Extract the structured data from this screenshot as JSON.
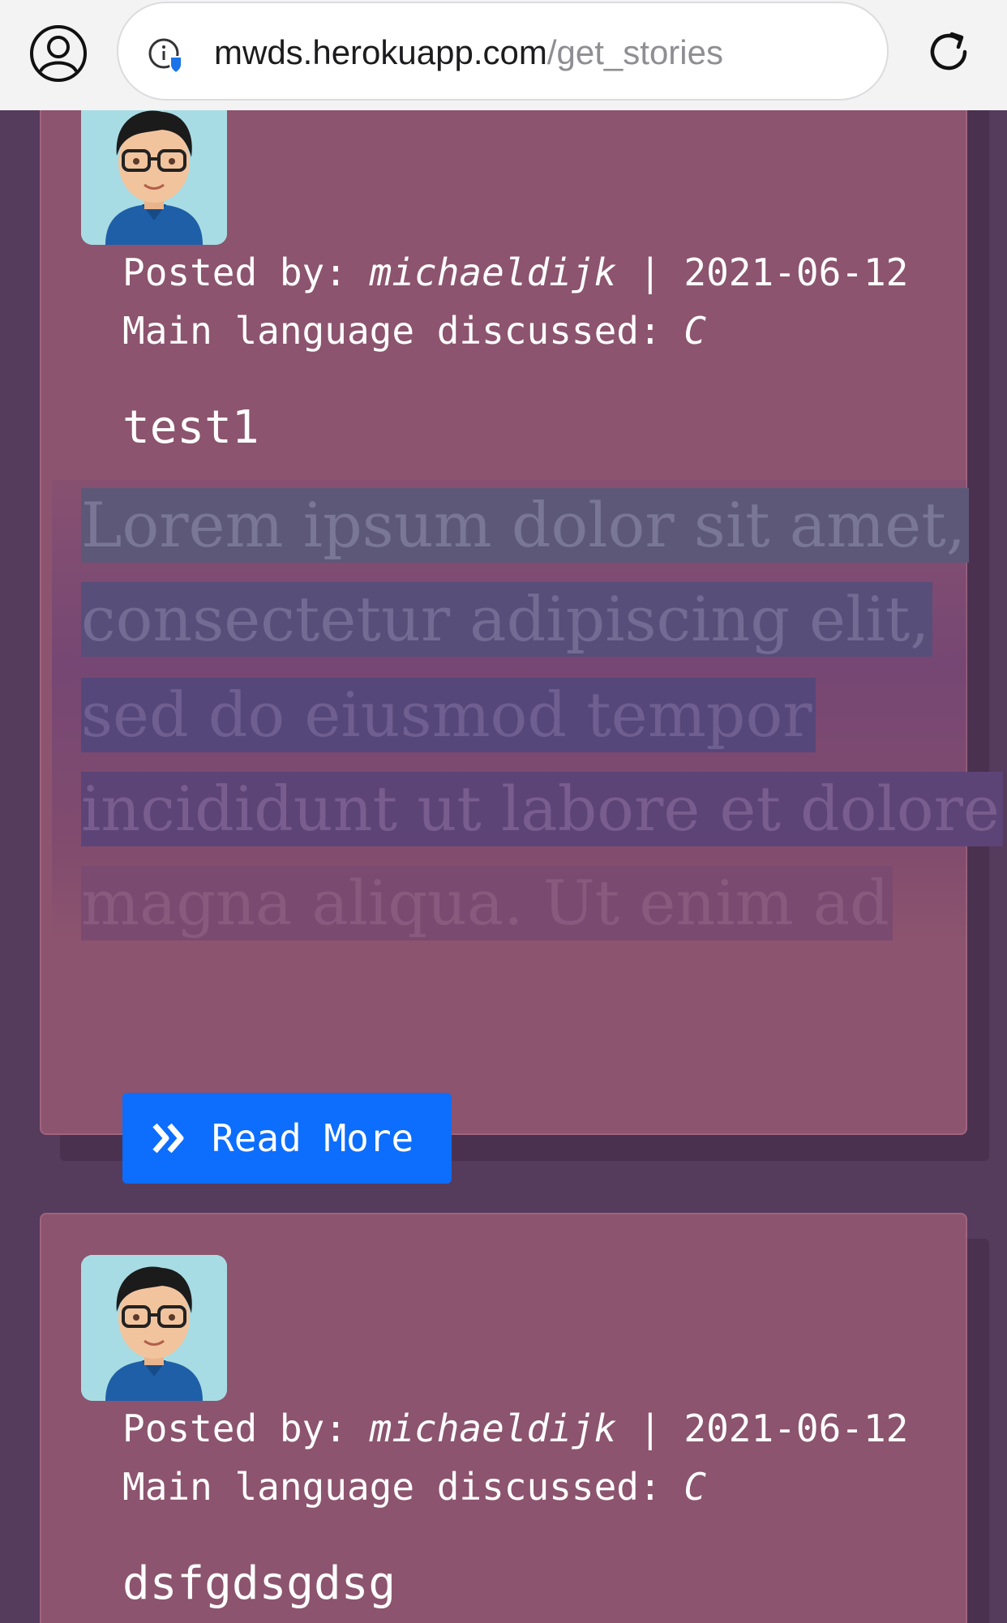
{
  "browser": {
    "url_domain": "mwds.herokuapp.com",
    "url_path": "/get_stories",
    "icons": [
      "profile-icon",
      "site-info-icon",
      "reload-icon"
    ]
  },
  "stories": [
    {
      "posted_by_label": "Posted by:",
      "author": "michaeldijk",
      "separator": "|",
      "date": "2021-06-12",
      "language_label": "Main language discussed:",
      "language": "C",
      "title": "test1",
      "excerpt_lines": [
        "Lorem ipsum dolor sit amet,",
        "consectetur adipiscing elit,",
        "sed do eiusmod tempor",
        "incididunt ut labore et dolore",
        "magna aliqua. Ut enim ad"
      ],
      "read_more_label": "Read More"
    },
    {
      "posted_by_label": "Posted by:",
      "author": "michaeldijk",
      "separator": "|",
      "date": "2021-06-12",
      "language_label": "Main language discussed:",
      "language": "C",
      "title": "dsfgdsgdsg"
    }
  ],
  "colors": {
    "page_bg": "#553b5c",
    "card_bg": "#8c546e",
    "button": "#0d6efd"
  }
}
